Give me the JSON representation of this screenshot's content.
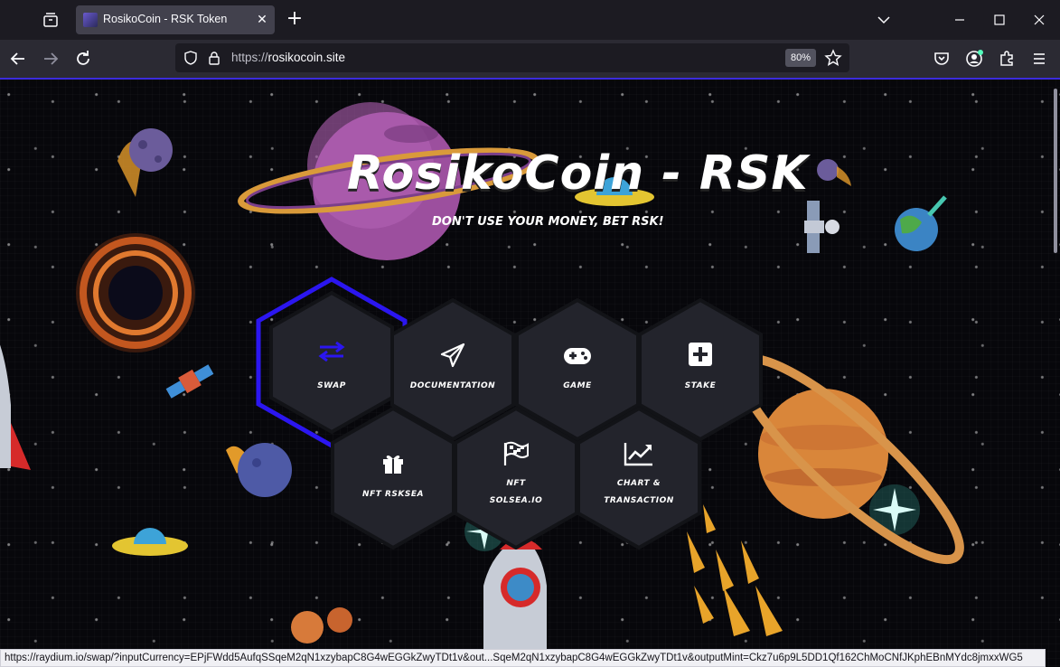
{
  "browser": {
    "tab_title": "RosikoCoin - RSK Token",
    "url_protocol": "https://",
    "url_host": "rosikocoin.site",
    "zoom": "80%",
    "status_url": "https://raydium.io/swap/?inputCurrency=EPjFWdd5AufqSSqeM2qN1xzybapC8G4wEGGkZwyTDt1v&out...SqeM2qN1xzybapC8G4wEGGkZwyTDt1v&outputMint=Ckz7u6p9L5DD1Qf162ChMoCNfJKphEBnMYdc8jmxxWG5"
  },
  "page": {
    "title": "RosikoCoin - RSK",
    "tagline": "DON'T USE YOUR MONEY, BET RSK!"
  },
  "menu": {
    "swap": "SWAP",
    "documentation": "DOCUMENTATION",
    "game": "GAME",
    "stake": "STAKE",
    "nft_rsksea": "NFT RSKSEA",
    "nft_solsea_line1": "NFT",
    "nft_solsea_line2": "SOLSEA.IO",
    "chart_line1": "CHART &",
    "chart_line2": "TRANSACTION"
  },
  "colors": {
    "accent": "#2b16f0",
    "hex_fill": "#23242c",
    "hex_border": "#121317"
  }
}
